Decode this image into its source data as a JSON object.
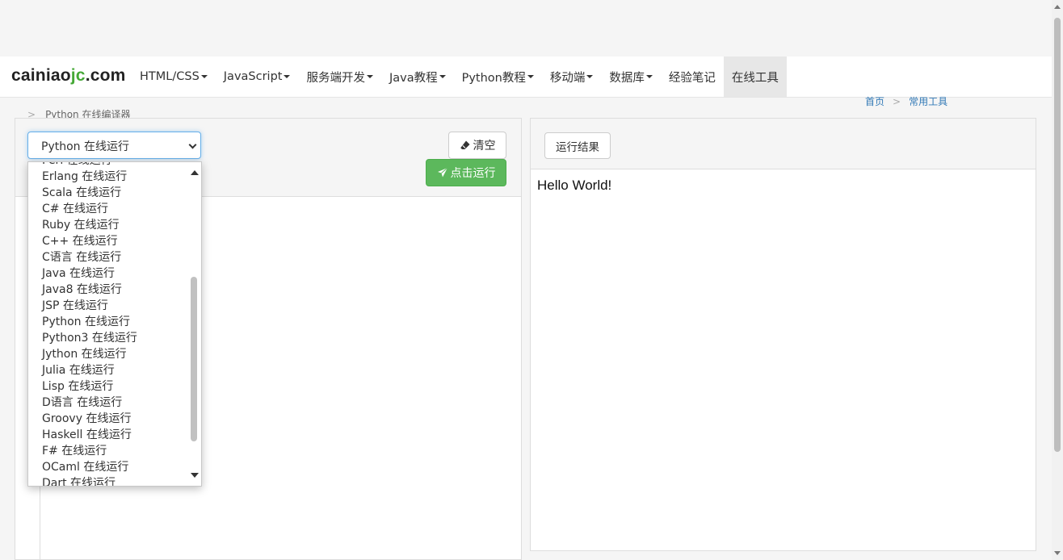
{
  "brand": {
    "part1": "cainiao",
    "part2": "jc",
    "part3": ".com"
  },
  "nav": [
    {
      "label": "HTML/CSS",
      "caret": true
    },
    {
      "label": "JavaScript",
      "caret": true
    },
    {
      "label": "服务端开发",
      "caret": true
    },
    {
      "label": "Java教程",
      "caret": true
    },
    {
      "label": "Python教程",
      "caret": true
    },
    {
      "label": "移动端",
      "caret": true
    },
    {
      "label": "数据库",
      "caret": true
    },
    {
      "label": "经验笔记",
      "caret": false
    },
    {
      "label": "在线工具",
      "caret": false,
      "active": true
    }
  ],
  "breadcrumb": {
    "separator": ">",
    "current": "Python 在线编译器",
    "home": "首页",
    "tools": "常用工具"
  },
  "editor": {
    "selected_language": "Python 在线运行",
    "clear_label": "清空",
    "run_label": "点击运行"
  },
  "dropdown_options": [
    "Perl 在线运行",
    "Erlang 在线运行",
    "Scala 在线运行",
    "C# 在线运行",
    "Ruby 在线运行",
    "C++ 在线运行",
    "C语言 在线运行",
    "Java 在线运行",
    "Java8 在线运行",
    "JSP 在线运行",
    "Python 在线运行",
    "Python3 在线运行",
    "Jython 在线运行",
    "Julia 在线运行",
    "Lisp 在线运行",
    "D语言 在线运行",
    "Groovy 在线运行",
    "Haskell 在线运行",
    "F# 在线运行",
    "OCaml 在线运行",
    "Dart 在线运行"
  ],
  "result": {
    "label": "运行结果",
    "output": "Hello World!"
  },
  "colors": {
    "brand_accent": "#45a836",
    "run_button": "#5cb85c",
    "link": "#337ab7"
  }
}
